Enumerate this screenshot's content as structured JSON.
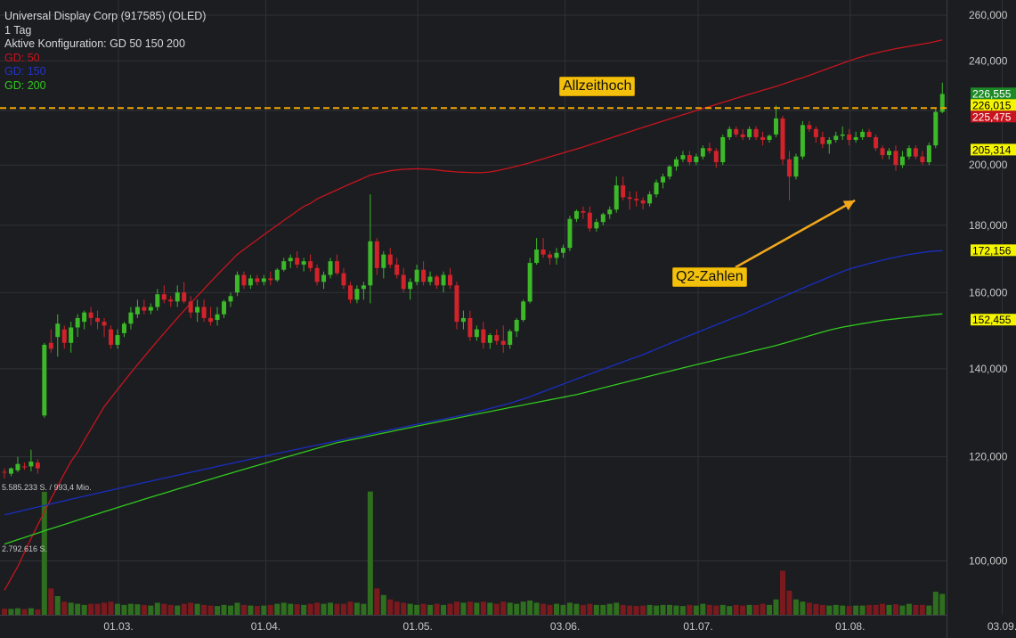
{
  "chart_data": {
    "type": "candlestick",
    "title": "Universal Display Corp (917585) (OLED)",
    "interval": "1 Tag",
    "config_label": "Aktive Konfiguration: GD 50 150 200",
    "legend": [
      {
        "label": "GD: 50",
        "color": "#c8141e"
      },
      {
        "label": "GD: 150",
        "color": "#1a2ec0"
      },
      {
        "label": "GD: 200",
        "color": "#32c81e"
      }
    ],
    "y_axis": {
      "scale": "log",
      "range": [
        91000,
        267000
      ],
      "ticks": [
        260000,
        240000,
        220000,
        200000,
        180000,
        160000,
        140000,
        120000,
        100000
      ],
      "tick_labels": [
        "260,000",
        "240,000",
        "",
        "200,000",
        "180,000",
        "160,000",
        "140,000",
        "120,000",
        "100,000"
      ]
    },
    "x_axis": {
      "ticks": [
        {
          "label": "01.03.",
          "date": "2021-03-01"
        },
        {
          "label": "01.04.",
          "date": "2021-04-01"
        },
        {
          "label": "01.05.",
          "date": "2021-05-03"
        },
        {
          "label": "03.06.",
          "date": "2021-06-03"
        },
        {
          "label": "01.07.",
          "date": "2021-07-01"
        },
        {
          "label": "01.08.",
          "date": "2021-08-02"
        },
        {
          "label": "03.09.",
          "date": "2021-09-03"
        }
      ]
    },
    "price_labels": [
      {
        "value": 226555,
        "label": "226,555",
        "color": "#1c8a24"
      },
      {
        "value": 226015,
        "label": "226,015",
        "color": "#f5f500"
      },
      {
        "value": 225475,
        "label": "225,475",
        "color": "#c8141e"
      },
      {
        "value": 205314,
        "label": "205,314",
        "color": "#f5f500"
      },
      {
        "value": 172156,
        "label": "172,156",
        "color": "#f5f500"
      },
      {
        "value": 152455,
        "label": "152,455",
        "color": "#f5f500"
      }
    ],
    "annotations": [
      {
        "text": "Allzeithoch",
        "type": "horizontal-line",
        "value": 221000,
        "color": "#f0a500"
      },
      {
        "text": "Q2-Zahlen",
        "type": "arrow",
        "target_date": "2021-08-03",
        "target_value": 188000
      }
    ],
    "volume_labels": [
      {
        "text": "5.585.233 S. / 993,4 Mio.",
        "value": 5585233
      },
      {
        "text": "2.792.616 S.",
        "value": 2792616
      }
    ],
    "volume_max": 5585233,
    "start_date": "2021-02-05",
    "ohlc": [
      [
        116.9,
        117.6,
        115.5,
        116.8
      ],
      [
        116.5,
        117.8,
        116,
        117.6
      ],
      [
        117.2,
        120,
        116.8,
        118.5
      ],
      [
        118,
        118.8,
        117.3,
        117.8
      ],
      [
        118,
        121.5,
        117,
        119
      ],
      [
        118.8,
        119.5,
        116.5,
        117.6
      ],
      [
        129,
        146.5,
        128.5,
        146
      ],
      [
        146.5,
        150,
        144,
        145
      ],
      [
        148,
        154,
        143,
        151.5
      ],
      [
        150,
        151,
        145,
        146.5
      ],
      [
        146.5,
        152,
        144,
        150.5
      ],
      [
        150.5,
        154,
        148,
        153
      ],
      [
        152,
        155,
        150,
        154.5
      ],
      [
        154.5,
        156,
        151,
        153
      ],
      [
        153,
        155,
        150,
        152
      ],
      [
        152,
        153,
        148,
        151
      ],
      [
        150,
        151,
        145,
        146
      ],
      [
        146,
        150,
        145,
        148.5
      ],
      [
        149,
        152,
        148,
        151.5
      ],
      [
        151.5,
        156,
        150,
        154.5
      ],
      [
        154,
        158,
        153,
        156
      ],
      [
        156,
        158,
        154,
        155
      ],
      [
        155,
        157,
        154,
        156
      ],
      [
        156,
        161,
        155,
        159.5
      ],
      [
        159.5,
        162,
        157,
        158
      ],
      [
        158,
        159,
        156,
        157.5
      ],
      [
        157.5,
        162,
        156,
        160
      ],
      [
        160,
        163,
        157,
        157.5
      ],
      [
        157.5,
        159,
        153,
        154.5
      ],
      [
        154.5,
        158,
        152,
        156
      ],
      [
        156,
        158,
        152,
        153
      ],
      [
        153,
        156,
        151,
        152
      ],
      [
        152.5,
        156,
        151,
        154
      ],
      [
        154,
        158,
        153,
        157.5
      ],
      [
        157.5,
        160,
        156,
        159
      ],
      [
        160,
        166,
        159,
        165
      ],
      [
        165,
        166,
        161,
        162
      ],
      [
        162,
        165,
        161,
        164
      ],
      [
        164,
        165,
        162,
        163
      ],
      [
        163,
        165,
        162,
        164
      ],
      [
        164,
        166,
        162,
        163.5
      ],
      [
        163.5,
        167,
        163,
        166.5
      ],
      [
        166.5,
        170,
        166,
        169
      ],
      [
        169,
        171,
        167,
        170
      ],
      [
        170,
        172,
        167,
        168
      ],
      [
        168,
        170,
        166,
        169
      ],
      [
        169,
        171,
        166,
        167
      ],
      [
        167,
        168,
        162,
        163
      ],
      [
        163,
        166,
        161,
        165
      ],
      [
        165,
        170,
        164,
        169
      ],
      [
        169,
        171,
        165,
        165.5
      ],
      [
        165.5,
        167,
        161,
        162
      ],
      [
        162,
        163,
        157,
        158
      ],
      [
        158,
        162,
        157,
        161
      ],
      [
        161,
        163,
        158,
        162
      ],
      [
        162,
        190,
        157,
        175
      ],
      [
        175,
        176,
        165,
        167
      ],
      [
        167,
        172,
        164,
        171
      ],
      [
        171,
        173,
        167,
        168
      ],
      [
        168,
        170,
        164,
        165
      ],
      [
        165,
        167,
        160,
        161
      ],
      [
        161,
        164,
        158,
        163
      ],
      [
        163,
        168,
        162,
        166.5
      ],
      [
        166.5,
        169,
        162,
        163
      ],
      [
        163,
        166,
        162,
        164.5
      ],
      [
        164.5,
        165,
        161,
        162
      ],
      [
        162,
        166,
        160,
        165
      ],
      [
        165,
        167,
        161,
        162
      ],
      [
        162,
        163,
        150,
        152
      ],
      [
        152,
        155,
        150,
        153
      ],
      [
        153,
        155,
        147,
        148
      ],
      [
        148,
        151,
        147,
        150
      ],
      [
        150,
        152,
        145,
        146.5
      ],
      [
        146.5,
        149,
        145,
        148.5
      ],
      [
        148.5,
        150,
        146,
        147
      ],
      [
        147,
        151,
        144,
        146
      ],
      [
        146,
        150,
        145,
        149.5
      ],
      [
        149.5,
        153,
        148,
        152.5
      ],
      [
        152.5,
        158,
        152,
        157.5
      ],
      [
        157.5,
        170,
        157,
        168.5
      ],
      [
        168.5,
        176,
        168,
        172.5
      ],
      [
        172.5,
        176,
        170,
        171
      ],
      [
        171,
        172,
        168,
        170
      ],
      [
        170,
        173,
        168,
        171.5
      ],
      [
        171.5,
        174,
        170,
        173
      ],
      [
        173,
        183,
        172,
        182
      ],
      [
        182,
        185,
        181,
        184.5
      ],
      [
        184.5,
        186,
        182,
        184
      ],
      [
        184,
        186,
        178,
        179
      ],
      [
        179,
        182,
        178,
        181
      ],
      [
        181,
        184,
        180,
        183.5
      ],
      [
        183.5,
        186,
        182,
        185
      ],
      [
        185,
        196,
        184,
        193
      ],
      [
        193,
        196,
        188,
        189
      ],
      [
        189,
        191,
        185,
        188.5
      ],
      [
        188.5,
        191,
        186,
        188
      ],
      [
        188,
        189,
        185,
        187
      ],
      [
        187,
        191,
        186,
        190
      ],
      [
        190,
        195,
        189,
        194
      ],
      [
        194,
        197,
        192,
        196
      ],
      [
        196,
        200,
        195,
        199.5
      ],
      [
        199.5,
        203,
        198,
        202
      ],
      [
        202,
        205,
        201,
        203.5
      ],
      [
        203.5,
        205,
        200,
        201
      ],
      [
        201,
        204,
        200,
        203
      ],
      [
        203,
        207,
        202,
        206
      ],
      [
        206,
        208,
        204,
        205
      ],
      [
        205,
        206,
        199,
        201
      ],
      [
        201,
        211,
        200,
        210
      ],
      [
        210,
        214,
        209,
        213
      ],
      [
        213,
        214,
        210,
        211
      ],
      [
        211,
        213,
        209,
        210
      ],
      [
        210,
        214,
        209,
        213
      ],
      [
        213,
        214,
        209,
        210
      ],
      [
        210,
        212,
        207,
        209
      ],
      [
        209,
        211,
        208,
        210.5
      ],
      [
        211,
        222,
        210,
        217
      ],
      [
        217,
        218,
        200,
        202
      ],
      [
        202,
        205,
        188,
        196
      ],
      [
        196,
        204,
        195,
        203
      ],
      [
        203,
        216,
        202,
        214.5
      ],
      [
        214.5,
        216,
        212,
        213
      ],
      [
        213,
        214,
        208,
        210
      ],
      [
        210,
        212,
        206,
        207.5
      ],
      [
        207.5,
        210,
        204,
        209
      ],
      [
        209,
        212,
        208,
        210.5
      ],
      [
        210.5,
        214,
        209,
        211
      ],
      [
        211,
        213,
        207,
        209
      ],
      [
        209,
        212,
        208,
        210
      ],
      [
        210,
        213,
        209,
        212
      ],
      [
        212,
        213,
        210,
        210
      ],
      [
        210,
        211,
        205,
        206
      ],
      [
        206,
        207,
        202,
        203.5
      ],
      [
        203.5,
        206,
        202,
        205
      ],
      [
        205,
        207,
        198,
        200
      ],
      [
        200,
        205,
        199,
        203
      ],
      [
        203,
        207,
        202,
        206
      ],
      [
        206,
        207,
        202,
        203
      ],
      [
        203,
        205,
        200,
        201
      ],
      [
        201,
        208,
        200,
        207
      ],
      [
        207,
        221,
        206,
        219.5
      ],
      [
        219.5,
        231,
        219,
        226.5
      ]
    ],
    "volume": [
      0.28,
      0.27,
      0.3,
      0.26,
      0.3,
      0.25,
      5.59,
      1.2,
      0.85,
      0.6,
      0.55,
      0.5,
      0.45,
      0.5,
      0.5,
      0.55,
      0.6,
      0.5,
      0.45,
      0.5,
      0.48,
      0.45,
      0.42,
      0.55,
      0.5,
      0.45,
      0.42,
      0.5,
      0.55,
      0.5,
      0.45,
      0.42,
      0.4,
      0.45,
      0.42,
      0.55,
      0.45,
      0.42,
      0.4,
      0.42,
      0.45,
      0.5,
      0.55,
      0.5,
      0.48,
      0.45,
      0.5,
      0.55,
      0.5,
      0.55,
      0.5,
      0.5,
      0.6,
      0.55,
      0.5,
      5.6,
      1.2,
      0.9,
      0.7,
      0.6,
      0.55,
      0.5,
      0.45,
      0.5,
      0.45,
      0.5,
      0.45,
      0.5,
      0.6,
      0.55,
      0.6,
      0.55,
      0.6,
      0.55,
      0.5,
      0.6,
      0.55,
      0.5,
      0.6,
      0.65,
      0.55,
      0.5,
      0.45,
      0.5,
      0.45,
      0.55,
      0.5,
      0.45,
      0.5,
      0.45,
      0.45,
      0.5,
      0.55,
      0.45,
      0.42,
      0.4,
      0.42,
      0.45,
      0.42,
      0.45,
      0.45,
      0.42,
      0.4,
      0.45,
      0.42,
      0.5,
      0.45,
      0.42,
      0.45,
      0.4,
      0.45,
      0.42,
      0.45,
      0.45,
      0.5,
      0.45,
      0.7,
      2.0,
      1.1,
      0.7,
      0.6,
      0.55,
      0.5,
      0.45,
      0.42,
      0.45,
      0.42,
      0.4,
      0.42,
      0.42,
      0.45,
      0.45,
      0.5,
      0.45,
      0.48,
      0.42,
      0.5,
      0.45,
      0.45,
      0.42,
      1.05,
      0.95
    ],
    "sma50": [
      95,
      97,
      99,
      101.5,
      104,
      106.5,
      109,
      111.5,
      114,
      116.5,
      119,
      121,
      123.5,
      126,
      128.5,
      131,
      133,
      135,
      137,
      139,
      141,
      143,
      145,
      147,
      149,
      151,
      153,
      155,
      157,
      159,
      161,
      163,
      165,
      167,
      169,
      171,
      172.5,
      174,
      175.5,
      177,
      178.5,
      180,
      181.5,
      183,
      184.5,
      186,
      187,
      188.5,
      189.5,
      190.5,
      191.5,
      192.5,
      193.5,
      194.5,
      195.5,
      196.5,
      197,
      197.5,
      198,
      198.3,
      198.5,
      198.6,
      198.7,
      198.6,
      198.5,
      198.3,
      198,
      197.8,
      197.6,
      197.5,
      197.4,
      197.3,
      197.4,
      197.6,
      198,
      198.5,
      199,
      199.6,
      200.2,
      200.8,
      201.5,
      202.2,
      202.9,
      203.6,
      204.3,
      205,
      205.7,
      206.4,
      207.2,
      208,
      208.8,
      209.6,
      210.4,
      211.2,
      212,
      212.8,
      213.6,
      214.4,
      215.2,
      216,
      216.8,
      217.6,
      218.4,
      219.2,
      220,
      220.8,
      221.6,
      222.4,
      223.2,
      224,
      224.8,
      225.6,
      226.4,
      227.2,
      228,
      228.7,
      229.5,
      230.4,
      231.3,
      232.2,
      233,
      234,
      235,
      236,
      237,
      238,
      239,
      240,
      241,
      241.8,
      242.6,
      243.3,
      244,
      244.6,
      245.2,
      245.7,
      246.2,
      246.7,
      247.2,
      247.7,
      248.3,
      249
    ],
    "sma150": [
      108.4,
      108.7,
      109,
      109.3,
      109.6,
      109.9,
      110.2,
      110.5,
      110.8,
      111.1,
      111.4,
      111.7,
      112,
      112.3,
      112.6,
      112.9,
      113.2,
      113.5,
      113.8,
      114.1,
      114.4,
      114.7,
      115,
      115.3,
      115.6,
      115.9,
      116.2,
      116.5,
      116.8,
      117.1,
      117.4,
      117.7,
      118,
      118.3,
      118.6,
      118.9,
      119.2,
      119.5,
      119.8,
      120.1,
      120.4,
      120.7,
      121,
      121.3,
      121.6,
      121.9,
      122.2,
      122.5,
      122.8,
      123.1,
      123.4,
      123.7,
      124,
      124.3,
      124.6,
      124.9,
      125.2,
      125.5,
      125.8,
      126.1,
      126.4,
      126.7,
      127,
      127.3,
      127.6,
      127.9,
      128.2,
      128.5,
      128.8,
      129.1,
      129.4,
      129.8,
      130.2,
      130.6,
      131,
      131.4,
      131.8,
      132.3,
      132.8,
      133.3,
      133.9,
      134.5,
      135.1,
      135.7,
      136.3,
      136.9,
      137.5,
      138.1,
      138.7,
      139.3,
      139.9,
      140.5,
      141.1,
      141.7,
      142.3,
      142.9,
      143.5,
      144.2,
      144.9,
      145.6,
      146.3,
      147,
      147.7,
      148.4,
      149.1,
      149.8,
      150.5,
      151.2,
      151.9,
      152.6,
      153.3,
      154,
      154.8,
      155.6,
      156.4,
      157.2,
      158,
      158.8,
      159.6,
      160.4,
      161.2,
      162,
      162.8,
      163.6,
      164.4,
      165.2,
      166,
      166.7,
      167.3,
      167.8,
      168.3,
      168.8,
      169.3,
      169.8,
      170.2,
      170.6,
      171,
      171.3,
      171.6,
      171.9,
      172.05,
      172.16
    ],
    "sma200": [
      103,
      103.4,
      103.8,
      104.2,
      104.6,
      105,
      105.4,
      105.8,
      106.2,
      106.6,
      107,
      107.4,
      107.8,
      108.2,
      108.6,
      109,
      109.4,
      109.8,
      110.2,
      110.6,
      111,
      111.4,
      111.8,
      112.2,
      112.6,
      113,
      113.4,
      113.8,
      114.2,
      114.6,
      115,
      115.4,
      115.8,
      116.2,
      116.6,
      117,
      117.4,
      117.8,
      118.2,
      118.6,
      119,
      119.4,
      119.8,
      120.2,
      120.6,
      121,
      121.4,
      121.8,
      122.2,
      122.6,
      123,
      123.3,
      123.6,
      123.9,
      124.2,
      124.5,
      124.8,
      125.1,
      125.4,
      125.7,
      126,
      126.3,
      126.6,
      126.9,
      127.2,
      127.5,
      127.8,
      128.1,
      128.4,
      128.7,
      129,
      129.3,
      129.6,
      129.9,
      130.2,
      130.5,
      130.8,
      131.1,
      131.4,
      131.7,
      132,
      132.3,
      132.6,
      132.9,
      133.2,
      133.5,
      133.8,
      134.2,
      134.6,
      135,
      135.4,
      135.8,
      136.2,
      136.6,
      137,
      137.4,
      137.8,
      138.2,
      138.6,
      139,
      139.4,
      139.8,
      140.2,
      140.6,
      141,
      141.4,
      141.8,
      142.2,
      142.6,
      143,
      143.4,
      143.8,
      144.2,
      144.6,
      145,
      145.4,
      145.8,
      146.3,
      146.8,
      147.3,
      147.8,
      148.3,
      148.8,
      149.3,
      149.8,
      150.2,
      150.6,
      150.9,
      151.2,
      151.5,
      151.8,
      152.1,
      152.4,
      152.6,
      152.8,
      153,
      153.2,
      153.4,
      153.6,
      153.8,
      154,
      154.1
    ]
  }
}
